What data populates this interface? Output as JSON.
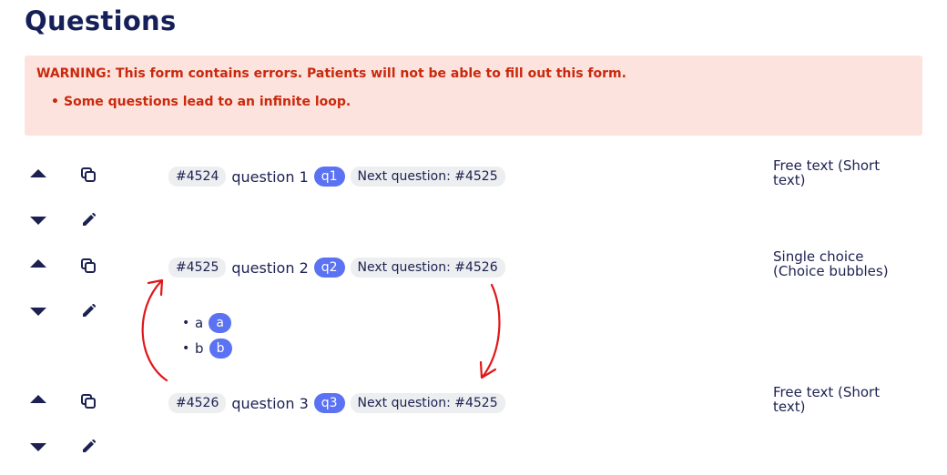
{
  "page": {
    "title": "Questions"
  },
  "warning": {
    "title": "WARNING: This form contains errors. Patients will not be able to fill out this form.",
    "items": [
      "Some questions lead to an infinite loop."
    ]
  },
  "questions": [
    {
      "id_label": "#4524",
      "text": "question 1",
      "variable": "q1",
      "next": "Next question: #4525",
      "type_line1": "Free text (Short",
      "type_line2": "text)"
    },
    {
      "id_label": "#4525",
      "text": "question 2",
      "variable": "q2",
      "next": "Next question: #4526",
      "type_line1": "Single choice",
      "type_line2": "(Choice bubbles)",
      "choices": [
        {
          "label": "a",
          "value": "a"
        },
        {
          "label": "b",
          "value": "b"
        }
      ]
    },
    {
      "id_label": "#4526",
      "text": "question 3",
      "variable": "q3",
      "next": "Next question: #4525",
      "type_line1": "Free text (Short",
      "type_line2": "text)"
    }
  ],
  "icons": {
    "move_up": "chevron-up-icon",
    "move_down": "chevron-down-icon",
    "duplicate": "copy-icon",
    "edit": "pencil-icon"
  },
  "colors": {
    "heading": "#162058",
    "warning_bg": "#fde3dd",
    "warning_text": "#c9290d",
    "chip_bg": "#eceef0",
    "badge_bg": "#5b72f2",
    "annotation": "#e0171a"
  }
}
